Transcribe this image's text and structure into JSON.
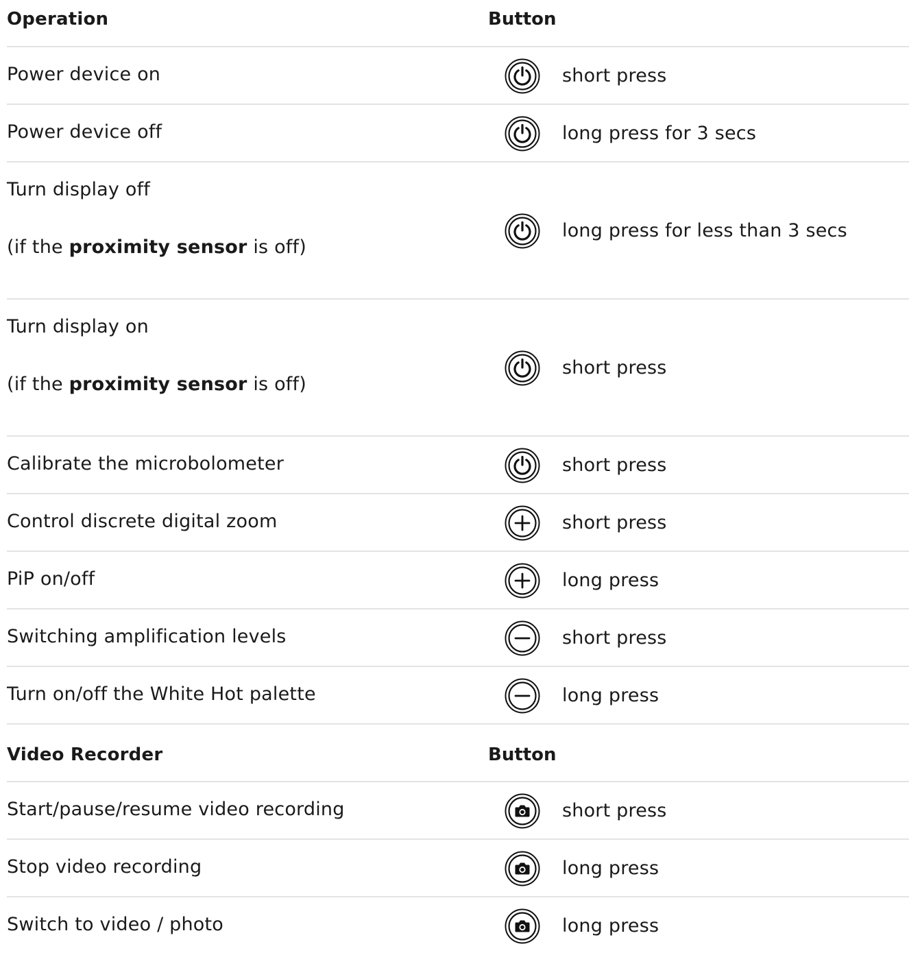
{
  "operations_section": {
    "header_operation": "Operation",
    "header_button": "Button",
    "rows": [
      {
        "operation": "Power device on",
        "icon": "power-icon",
        "press": "short press"
      },
      {
        "operation": "Power device off",
        "icon": "power-icon",
        "press": "long press for 3 secs"
      },
      {
        "operation_line1": "Turn display off",
        "note_prefix": "(if the ",
        "note_bold": "proximity sensor",
        "note_suffix": " is off)",
        "icon": "power-icon",
        "press": "long press for less than 3 secs"
      },
      {
        "operation_line1": "Turn display on",
        "note_prefix": "(if the ",
        "note_bold": "proximity sensor",
        "note_suffix": " is off)",
        "icon": "power-icon",
        "press": "short press"
      },
      {
        "operation": "Calibrate the microbolometer",
        "icon": "power-icon",
        "press": "short press"
      },
      {
        "operation": "Control discrete digital zoom",
        "icon": "plus-icon",
        "press": "short press"
      },
      {
        "operation": "PiP on/off",
        "icon": "plus-icon",
        "press": "long press"
      },
      {
        "operation": "Switching amplification levels",
        "icon": "minus-icon",
        "press": "short press"
      },
      {
        "operation": "Turn on/off the White Hot palette",
        "icon": "minus-icon",
        "press": "long press"
      }
    ]
  },
  "video_section": {
    "header_operation": "Video Recorder",
    "header_button": "Button",
    "rows": [
      {
        "operation": "Start/pause/resume video recording",
        "icon": "camera-icon",
        "press": "short press"
      },
      {
        "operation": "Stop video recording",
        "icon": "camera-icon",
        "press": "long press"
      },
      {
        "operation": "Switch to video / photo",
        "icon": "camera-icon",
        "press": "long press"
      }
    ]
  }
}
